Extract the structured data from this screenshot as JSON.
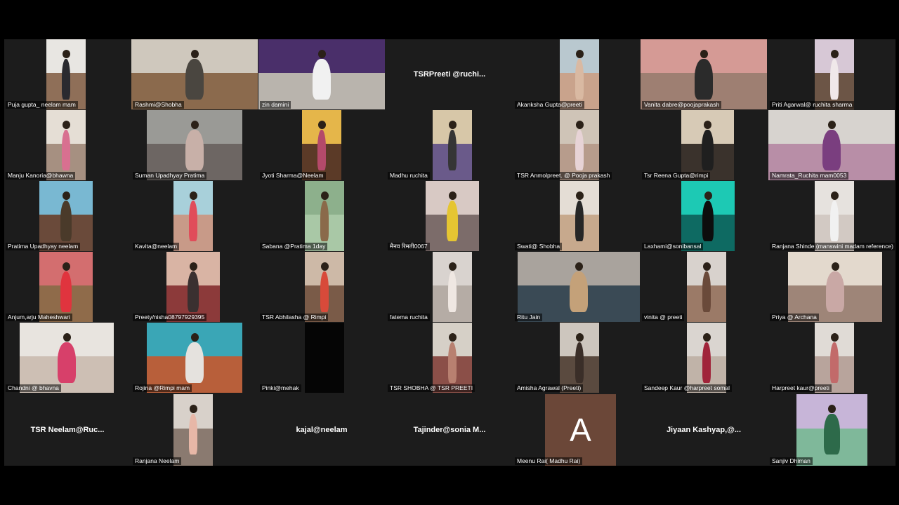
{
  "meeting": {
    "tiles": [
      {
        "name": "Puja gupta_ neelam mam",
        "kind": "video",
        "c1": "#e8e6e2",
        "c2": "#8f6f58",
        "fig": "#2a2a2f"
      },
      {
        "name": "Rashmi@Shobha",
        "kind": "video",
        "c1": "#cfc8bd",
        "c2": "#8b6a4d",
        "fig": "#4a4640"
      },
      {
        "name": "zin damini",
        "kind": "video",
        "c1": "#4a2f6a",
        "c2": "#b9b4ad",
        "fig": "#f1f1f1"
      },
      {
        "name": "TSRPreeti @ruchi...",
        "kind": "name"
      },
      {
        "name": "Akanksha Gupta@preeti",
        "kind": "video",
        "c1": "#b9c8cf",
        "c2": "#c9a38c",
        "fig": "#d9b9a2"
      },
      {
        "name": "Vanita dabre@poojaprakash",
        "kind": "video",
        "c1": "#d59a95",
        "c2": "#9e7f72",
        "fig": "#2b2b2b"
      },
      {
        "name": "Priti Agarwal@ ruchita sharma",
        "kind": "video",
        "c1": "#d7c8d6",
        "c2": "#6c5546",
        "fig": "#f0e8ea"
      },
      {
        "name": "Manju Kanoria@bhawna",
        "kind": "video",
        "c1": "#e5ded5",
        "c2": "#a69081",
        "fig": "#d87090"
      },
      {
        "name": "Suman Upadhyay  Pratima",
        "kind": "video",
        "c1": "#9a9a96",
        "c2": "#6d6663",
        "fig": "#c8b0a8"
      },
      {
        "name": "Jyoti Sharma@Neelam",
        "kind": "video",
        "c1": "#e5b64a",
        "c2": "#5b3a27",
        "fig": "#b44a6a"
      },
      {
        "name": "Madhu ruchita",
        "kind": "video",
        "c1": "#d7c7a8",
        "c2": "#6a5a8a",
        "fig": "#353535"
      },
      {
        "name": "TSR Anmolpreet. @ Pooja prakash",
        "kind": "video",
        "c1": "#cfc4b7",
        "c2": "#b79c8c",
        "fig": "#e7d3d6"
      },
      {
        "name": "Tsr Reena Gupta@rimpi",
        "kind": "video",
        "c1": "#d7cab6",
        "c2": "#3a322c",
        "fig": "#1f1f1f"
      },
      {
        "name": "Namrata_Ruchita mam0053",
        "kind": "video",
        "c1": "#d7d3cf",
        "c2": "#b88ea7",
        "fig": "#7a3e7f"
      },
      {
        "name": "Pratima Upadhyay  neelam",
        "kind": "video",
        "c1": "#79b8d2",
        "c2": "#6a4a3a",
        "fig": "#4a3a2a"
      },
      {
        "name": "Kavita@neelam",
        "kind": "video",
        "c1": "#a8d0da",
        "c2": "#c89a88",
        "fig": "#e04d5a"
      },
      {
        "name": "Sabana @Pratima 1day",
        "kind": "video",
        "c1": "#8db08c",
        "c2": "#a9c8a6",
        "fig": "#8a6a4a"
      },
      {
        "name": "मैनव रिमती0067",
        "kind": "video",
        "c1": "#d8c9c4",
        "c2": "#7c6c6a",
        "fig": "#e5c532"
      },
      {
        "name": "Swati@ Shobha",
        "kind": "video",
        "c1": "#e4ddd5",
        "c2": "#c7a98d",
        "fig": "#262626"
      },
      {
        "name": "Laxhami@sonibansal",
        "kind": "video",
        "c1": "#1dc9b4",
        "c2": "#0e6a62",
        "fig": "#0d0d0d"
      },
      {
        "name": "Ranjana Shinde (manswini madam reference)",
        "kind": "video",
        "c1": "#e6e2de",
        "c2": "#d2c9c3",
        "fig": "#f1f1f1"
      },
      {
        "name": "Anjum,arju Maheshwari",
        "kind": "video",
        "c1": "#d36e6f",
        "c2": "#8f6b4a",
        "fig": "#e0343e"
      },
      {
        "name": "Preety/nisha08797929395",
        "kind": "video",
        "c1": "#d9b4a4",
        "c2": "#8c3a3a",
        "fig": "#3a3030"
      },
      {
        "name": "TSR Abhilasha @ Rimpi",
        "kind": "video",
        "c1": "#cdb9a7",
        "c2": "#7a5b48",
        "fig": "#d84a3a"
      },
      {
        "name": "fatema ruchita",
        "kind": "video",
        "c1": "#d9d3cf",
        "c2": "#b5aca5",
        "fig": "#efe7e2"
      },
      {
        "name": "Ritu Jain",
        "kind": "video",
        "c1": "#a9a39d",
        "c2": "#3a4a55",
        "fig": "#c4a179"
      },
      {
        "name": "vinita @ preeti",
        "kind": "video",
        "c1": "#d8d2cd",
        "c2": "#9b7a67",
        "fig": "#6a4a3a"
      },
      {
        "name": "Priya @ Archana",
        "kind": "video",
        "c1": "#e3d9cd",
        "c2": "#9e8578",
        "fig": "#c9a8a5"
      },
      {
        "name": "Chandni @ bhavna",
        "kind": "video",
        "c1": "#e8e4df",
        "c2": "#cdbfb4",
        "fig": "#d7406a"
      },
      {
        "name": "Rojina @Rimpi  mam",
        "kind": "video",
        "c1": "#3aa6b6",
        "c2": "#b85f3a",
        "fig": "#e5e2de"
      },
      {
        "name": "Pinki@mehak",
        "kind": "video",
        "c1": "#050505",
        "c2": "#050505",
        "fig": "#050505"
      },
      {
        "name": "TSR SHOBHA @ TSR PREETI",
        "kind": "video",
        "c1": "#d6d0c7",
        "c2": "#8b4f48",
        "fig": "#b88070"
      },
      {
        "name": "Amisha Agrawal (Preeti)",
        "kind": "video",
        "c1": "#cdc6be",
        "c2": "#5a4a3f",
        "fig": "#3a2e28"
      },
      {
        "name": "Sandeep Kaur @harpreet somal",
        "kind": "video",
        "c1": "#dad5d0",
        "c2": "#c0b3a8",
        "fig": "#a0243a"
      },
      {
        "name": "Harpreet kaur@preeti",
        "kind": "video",
        "c1": "#e0dbd6",
        "c2": "#b8a49c",
        "fig": "#c26a6a"
      },
      {
        "name": "TSR  Neelam@Ruc...",
        "kind": "name"
      },
      {
        "name": "Ranjana Neelam",
        "kind": "video",
        "c1": "#d8d1ca",
        "c2": "#8a7a70",
        "fig": "#e7b7a7"
      },
      {
        "name": "kajal@neelam",
        "kind": "name"
      },
      {
        "name": "Tajinder@sonia  M...",
        "kind": "name"
      },
      {
        "name": "Meenu Rai( Madhu Rai)",
        "kind": "avatar",
        "letter": "A",
        "color": "#6b4738"
      },
      {
        "name": "Jiyaan  Kashyap,@...",
        "kind": "name"
      },
      {
        "name": "Sanjiv Dhiman",
        "kind": "video",
        "c1": "#c7b5d8",
        "c2": "#7fb89a",
        "fig": "#2d6a4a"
      }
    ]
  }
}
